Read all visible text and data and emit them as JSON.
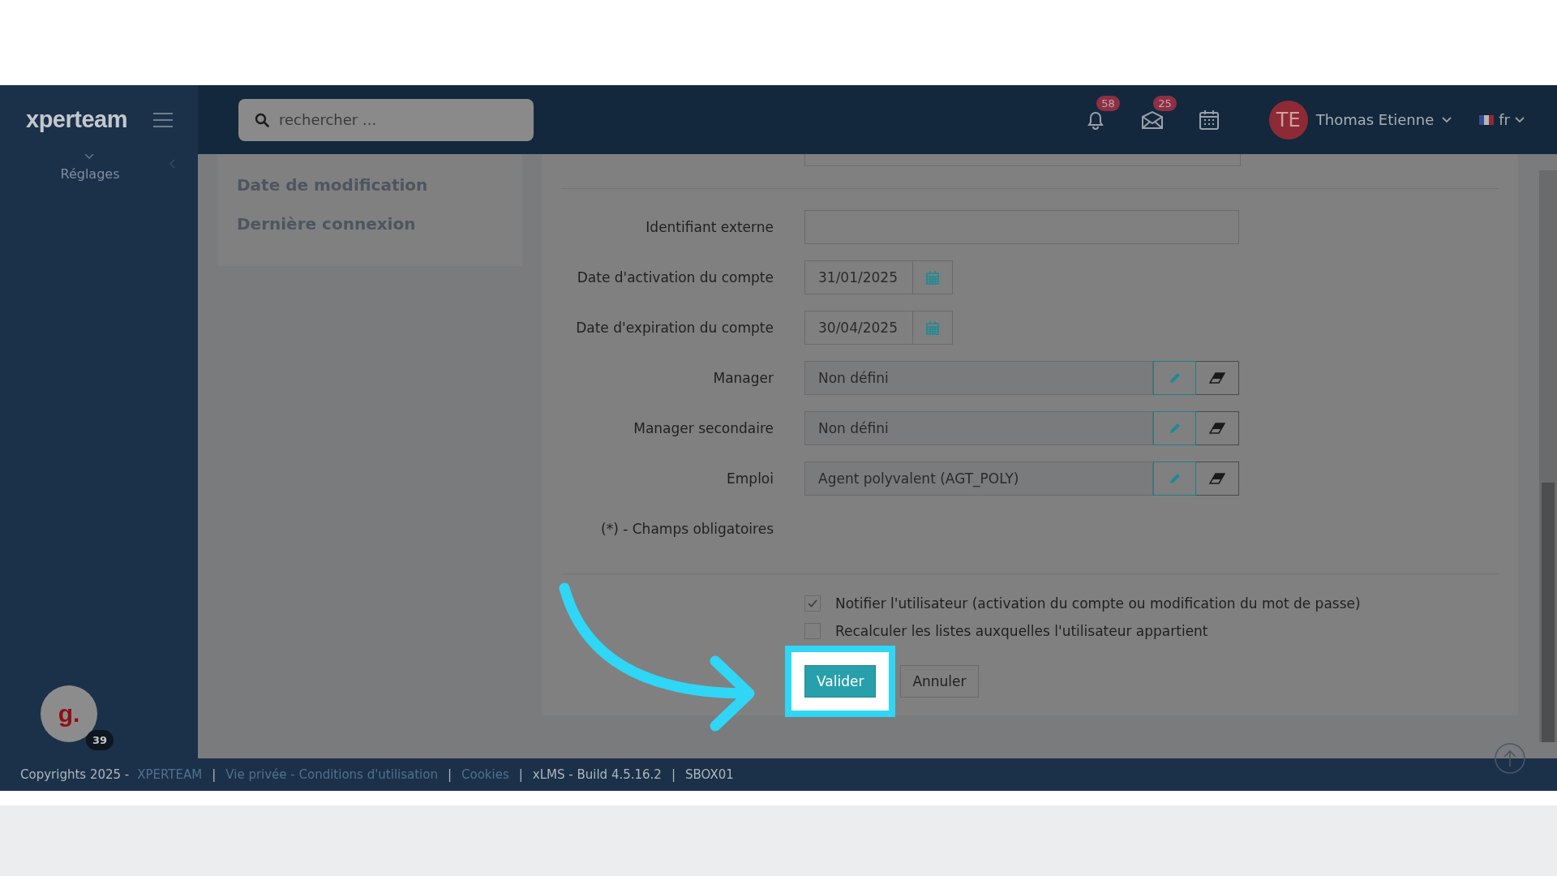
{
  "header": {
    "logo": "xperteam",
    "search": {
      "placeholder": "rechercher ..."
    },
    "notifications": "58",
    "messages": "25",
    "user": {
      "initials": "TE",
      "name": "Thomas Etienne"
    },
    "language": "fr"
  },
  "sidebar": {
    "items": [
      {
        "label": "Réglages"
      }
    ]
  },
  "side_panel": {
    "items": [
      "Date de modification",
      "Dernière connexion"
    ]
  },
  "form": {
    "fields": [
      {
        "label": "Identifiant externe",
        "kind": "text"
      },
      {
        "label": "Date d'activation du compte",
        "kind": "date",
        "value": "31/01/2025"
      },
      {
        "label": "Date d'expiration du compte",
        "kind": "date",
        "value": "30/04/2025"
      },
      {
        "label": "Manager",
        "kind": "picker",
        "value": "Non défini"
      },
      {
        "label": "Manager secondaire",
        "kind": "picker",
        "value": "Non défini"
      },
      {
        "label": "Emploi",
        "kind": "picker",
        "value": "Agent polyvalent (AGT_POLY)"
      }
    ],
    "note": "(*) - Champs obligatoires",
    "options": [
      {
        "label": "Notifier l'utilisateur (activation du compte ou modification du mot de passe)",
        "checked": true
      },
      {
        "label": "Recalculer les listes auxquelles l'utilisateur appartient",
        "checked": false
      }
    ],
    "buttons": [
      {
        "label": "Valider",
        "kind": "primary",
        "highlighted": true
      },
      {
        "label": "Annuler",
        "kind": "secondary",
        "highlighted": false
      }
    ]
  },
  "widget": {
    "logo": "g.",
    "badge": "39"
  },
  "footer": {
    "items": [
      {
        "text": "Copyrights 2025 -",
        "kind": "text"
      },
      {
        "text": "XPERTEAM",
        "kind": "link"
      },
      {
        "text": "|",
        "kind": "separator"
      },
      {
        "text": "Vie privée - Conditions d'utilisation",
        "kind": "link"
      },
      {
        "text": "|",
        "kind": "separator"
      },
      {
        "text": "Cookies",
        "kind": "link"
      },
      {
        "text": "|",
        "kind": "separator"
      },
      {
        "text": "xLMS - Build 4.5.16.2",
        "kind": "text"
      },
      {
        "text": "|",
        "kind": "separator"
      },
      {
        "text": "SBOX01",
        "kind": "text"
      }
    ]
  }
}
